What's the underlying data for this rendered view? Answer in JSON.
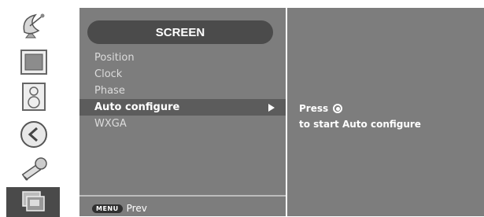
{
  "sidebar": {
    "icons": [
      {
        "name": "satellite-dish-icon",
        "selected": false
      },
      {
        "name": "picture-icon",
        "selected": false
      },
      {
        "name": "speaker-icon",
        "selected": false
      },
      {
        "name": "time-icon",
        "selected": false
      },
      {
        "name": "key-icon",
        "selected": false
      },
      {
        "name": "screen-icon",
        "selected": true
      }
    ]
  },
  "menu": {
    "title": "SCREEN",
    "items": [
      {
        "label": "Position"
      },
      {
        "label": "Clock"
      },
      {
        "label": "Phase"
      },
      {
        "label": "Auto configure",
        "active": true
      },
      {
        "label": "WXGA"
      }
    ],
    "footer": {
      "key_label": "MENU",
      "action_label": "Prev"
    }
  },
  "info": {
    "line1": "Press",
    "line2": "to start Auto configure"
  },
  "colors": {
    "panel": "#7d7d7d",
    "title_bar": "#4b4b4b",
    "active_row": "#5c5c5c",
    "text": "#ffffff"
  }
}
